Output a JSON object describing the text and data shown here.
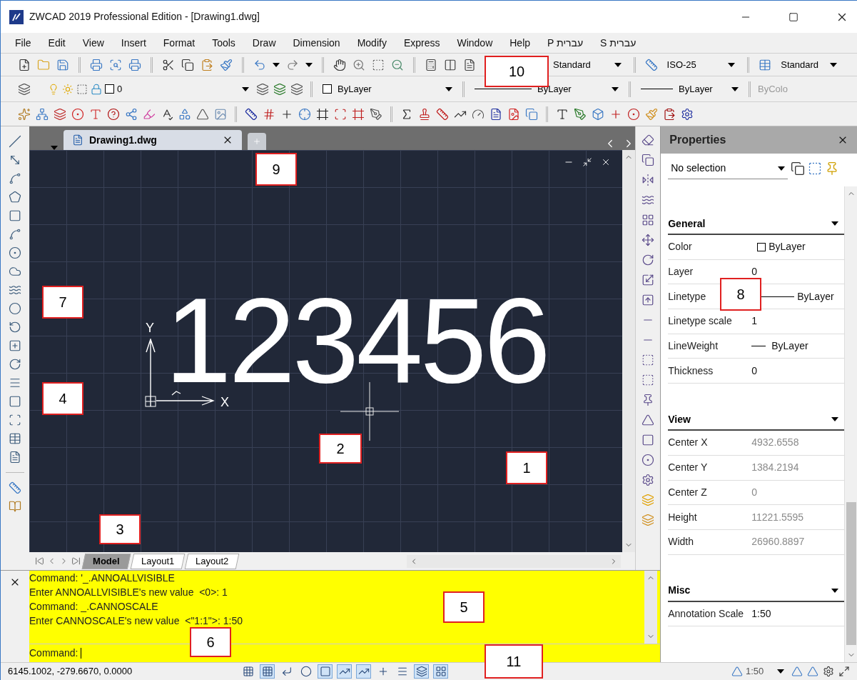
{
  "window": {
    "title": "ZWCAD 2019 Professional Edition - [Drawing1.dwg]"
  },
  "menu": [
    "File",
    "Edit",
    "View",
    "Insert",
    "Format",
    "Tools",
    "Draw",
    "Dimension",
    "Modify",
    "Express",
    "Window",
    "Help",
    "P עברית",
    "S עברית"
  ],
  "style_toolbar": {
    "text_style": "Standard",
    "dim_style": "ISO-25",
    "table_style": "Standard"
  },
  "layer_toolbar": {
    "layer": "0",
    "color_control": "ByLayer",
    "linetype": "ByLayer",
    "lineweight": "ByLayer",
    "plot_style": "ByColo"
  },
  "document_tabs": [
    {
      "label": "Drawing1.dwg",
      "selected": true
    }
  ],
  "canvas": {
    "text": "123456",
    "ucs_x": "X",
    "ucs_y": "Y"
  },
  "layout_tabs": [
    {
      "label": "Model",
      "selected": true
    },
    {
      "label": "Layout1",
      "selected": false
    },
    {
      "label": "Layout2",
      "selected": false
    }
  ],
  "properties": {
    "title": "Properties",
    "selection": "No selection",
    "sections": [
      {
        "title": "General",
        "rows": [
          {
            "name": "Color",
            "value": "ByLayer",
            "kind": "color",
            "dimmed": false
          },
          {
            "name": "Layer",
            "value": "0",
            "kind": "text",
            "dimmed": false
          },
          {
            "name": "Linetype",
            "value": "ByLayer",
            "kind": "line",
            "dimmed": false
          },
          {
            "name": "Linetype scale",
            "value": "1",
            "kind": "text",
            "dimmed": false
          },
          {
            "name": "LineWeight",
            "value": "ByLayer",
            "kind": "short_line",
            "dimmed": false
          },
          {
            "name": "Thickness",
            "value": "0",
            "kind": "text",
            "dimmed": false
          }
        ]
      },
      {
        "title": "View",
        "rows": [
          {
            "name": "Center X",
            "value": "4932.6558",
            "kind": "text",
            "dimmed": true
          },
          {
            "name": "Center Y",
            "value": "1384.2194",
            "kind": "text",
            "dimmed": true
          },
          {
            "name": "Center Z",
            "value": "0",
            "kind": "text",
            "dimmed": true
          },
          {
            "name": "Height",
            "value": "11221.5595",
            "kind": "text",
            "dimmed": true
          },
          {
            "name": "Width",
            "value": "26960.8897",
            "kind": "text",
            "dimmed": true
          }
        ]
      },
      {
        "title": "Misc",
        "rows": [
          {
            "name": "Annotation Scale",
            "value": "1:50",
            "kind": "text",
            "dimmed": false
          }
        ]
      }
    ]
  },
  "command_line": {
    "history": [
      "Command: '_.ANNOALLVISIBLE",
      "Enter ANNOALLVISIBLE's new value  <0>: 1",
      "Command: _.CANNOSCALE",
      "Enter CANNOSCALE's new value  <\"1:1\">: 1:50"
    ],
    "prompt": "Command:"
  },
  "status_bar": {
    "coordinates": "6145.1002, -279.6670, 0.0000",
    "toggles": [
      {
        "on": false
      },
      {
        "on": true
      },
      {
        "on": false
      },
      {
        "on": false
      },
      {
        "on": true
      },
      {
        "on": true
      },
      {
        "on": true
      },
      {
        "on": false
      },
      {
        "on": false
      },
      {
        "on": true
      },
      {
        "on": true
      }
    ],
    "annotation_scale": "1:50"
  },
  "callouts": [
    {
      "label": "10"
    },
    {
      "label": "9"
    },
    {
      "label": "7"
    },
    {
      "label": "8"
    },
    {
      "label": "4"
    },
    {
      "label": "2"
    },
    {
      "label": "1"
    },
    {
      "label": "3"
    },
    {
      "label": "5"
    },
    {
      "label": "6"
    },
    {
      "label": "11"
    }
  ]
}
